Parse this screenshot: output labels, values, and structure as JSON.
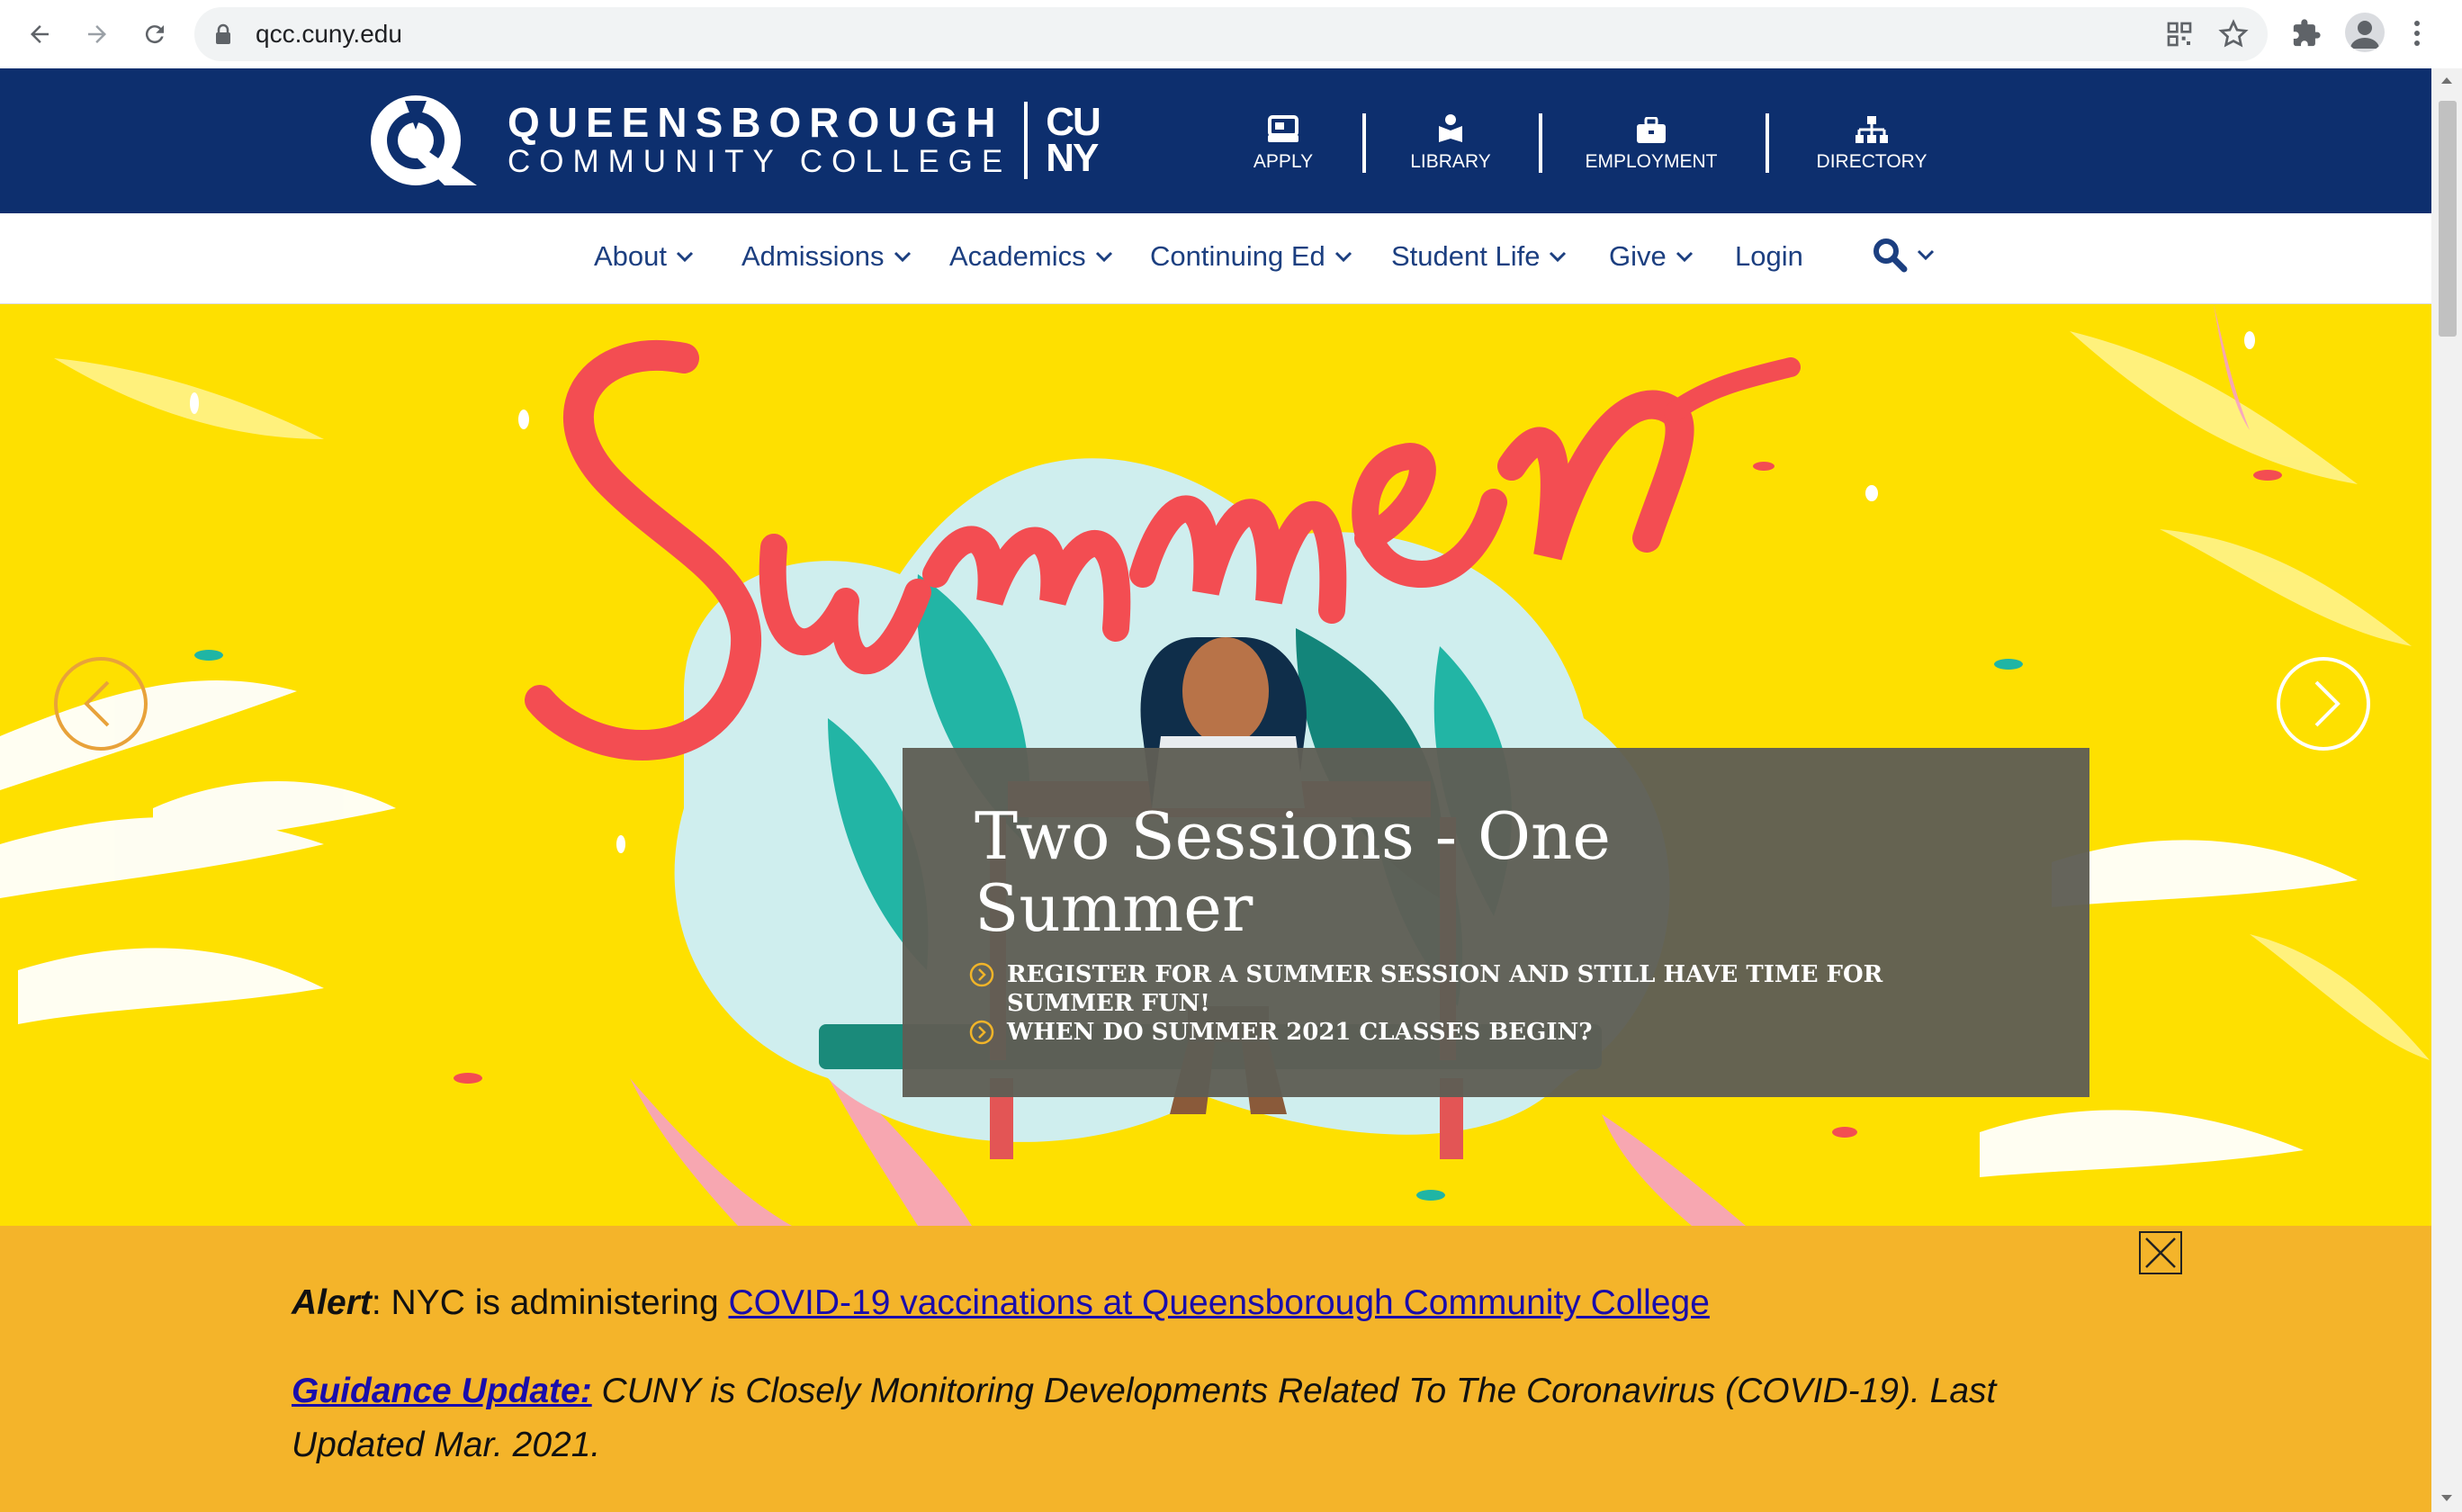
{
  "browser": {
    "url": "qcc.cuny.edu"
  },
  "header": {
    "logo_line1": "QUEENSBOROUGH",
    "logo_line2": "COMMUNITY COLLEGE",
    "cuny_line1": "CU",
    "cuny_line2": "NY",
    "utility_links": [
      {
        "label": "APPLY",
        "icon": "apply-icon"
      },
      {
        "label": "LIBRARY",
        "icon": "library-icon"
      },
      {
        "label": "EMPLOYMENT",
        "icon": "briefcase-icon"
      },
      {
        "label": "DIRECTORY",
        "icon": "org-chart-icon"
      }
    ]
  },
  "nav": {
    "items": [
      "About",
      "Admissions",
      "Academics",
      "Continuing Ed",
      "Student Life",
      "Give",
      "Login"
    ],
    "search_icon": "search-icon"
  },
  "hero": {
    "script_word": "Summer",
    "title": "Two Sessions - One Summer",
    "links": [
      "REGISTER FOR A SUMMER SESSION AND STILL HAVE TIME FOR SUMMER FUN!",
      "WHEN DO SUMMER 2021 CLASSES BEGIN?"
    ]
  },
  "alert": {
    "prefix": "Alert",
    "text": ": NYC is administering ",
    "link": "COVID-19 vaccinations at Queensborough Community College",
    "guidance_link": "Guidance Update:",
    "guidance_text": " CUNY is Closely Monitoring Developments Related To The Coronavirus (COVID-19). Last Updated Mar. 2021."
  },
  "colors": {
    "navy": "#0d2f6e",
    "hero_yellow": "#fee000",
    "alert_orange": "#f4b42a",
    "summer_red": "#f34d52"
  }
}
